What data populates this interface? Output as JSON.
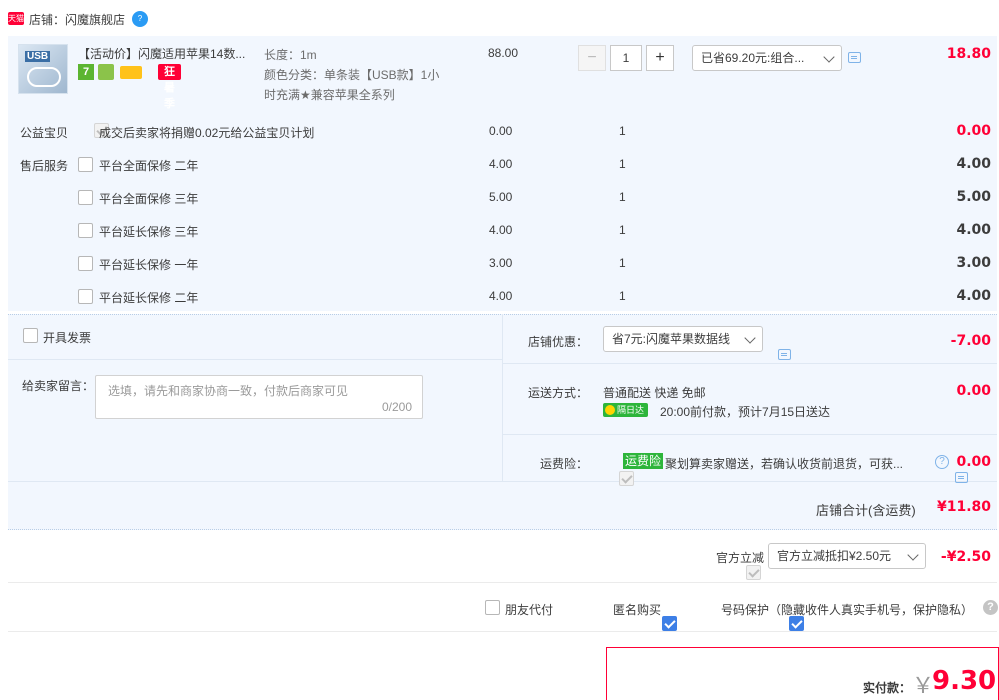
{
  "shop": {
    "badge": "天猫",
    "label": "店铺：闪魔旗舰店",
    "help": "?"
  },
  "item": {
    "thumb_text": "USB",
    "title": "【活动价】闪魔适用苹果14数...",
    "promo_badge": "狂暑季",
    "icon_badge_1": "7",
    "spec_length": "长度：1m",
    "spec_color": "颜色分类：单条装【USB款】1小时充满★兼容苹果全系列",
    "unit_price": "88.00",
    "qty": "1",
    "discount_select": "已省69.20元:组合...",
    "subtotal": "18.80"
  },
  "services": {
    "charity_label": "公益宝贝",
    "charity_text": "成交后卖家将捐赠0.02元给公益宝贝计划",
    "charity_price": "0.00",
    "charity_qty": "1",
    "charity_total": "0.00",
    "aftersale_label": "售后服务",
    "options": [
      {
        "name": "平台全面保修 二年",
        "price": "4.00",
        "qty": "1",
        "total": "4.00"
      },
      {
        "name": "平台全面保修 三年",
        "price": "5.00",
        "qty": "1",
        "total": "5.00"
      },
      {
        "name": "平台延长保修 三年",
        "price": "4.00",
        "qty": "1",
        "total": "4.00"
      },
      {
        "name": "平台延长保修 一年",
        "price": "3.00",
        "qty": "1",
        "total": "3.00"
      },
      {
        "name": "平台延长保修 二年",
        "price": "4.00",
        "qty": "1",
        "total": "4.00"
      }
    ]
  },
  "invoice": {
    "label": "开具发票"
  },
  "message": {
    "label": "给卖家留言：",
    "placeholder": "选填，请先和商家协商一致，付款后商家可见",
    "counter": "0/200"
  },
  "shop_discount": {
    "label": "店铺优惠：",
    "select": "省7元:闪魔苹果数据线",
    "amount": "-7.00"
  },
  "shipping": {
    "label": "运送方式：",
    "method": "普通配送 快递 免邮",
    "badge": "隔日达",
    "eta": "20:00前付款，预计7月15日送达",
    "amount": "0.00"
  },
  "insurance": {
    "label": "运费险：",
    "badge": "运费险",
    "text": "聚划算卖家赠送，若确认收货前退货，可获...",
    "amount": "0.00"
  },
  "shop_total": {
    "label": "店铺合计(含运费)",
    "amount": "¥11.80"
  },
  "official": {
    "label": "官方立减",
    "select": "官方立减抵扣¥2.50元",
    "amount": "-¥2.50"
  },
  "options_bar": {
    "friend_pay": "朋友代付",
    "anonymous": "匿名购买",
    "number_protect": "号码保护（隐藏收件人真实手机号，保护隐私）"
  },
  "pay": {
    "label": "实付款：",
    "currency": "￥",
    "amount": "9.30"
  },
  "colors": {
    "accent_red": "#ff0036",
    "blue_bg": "#f2f7fe",
    "brand_blue": "#3d7fe6"
  }
}
